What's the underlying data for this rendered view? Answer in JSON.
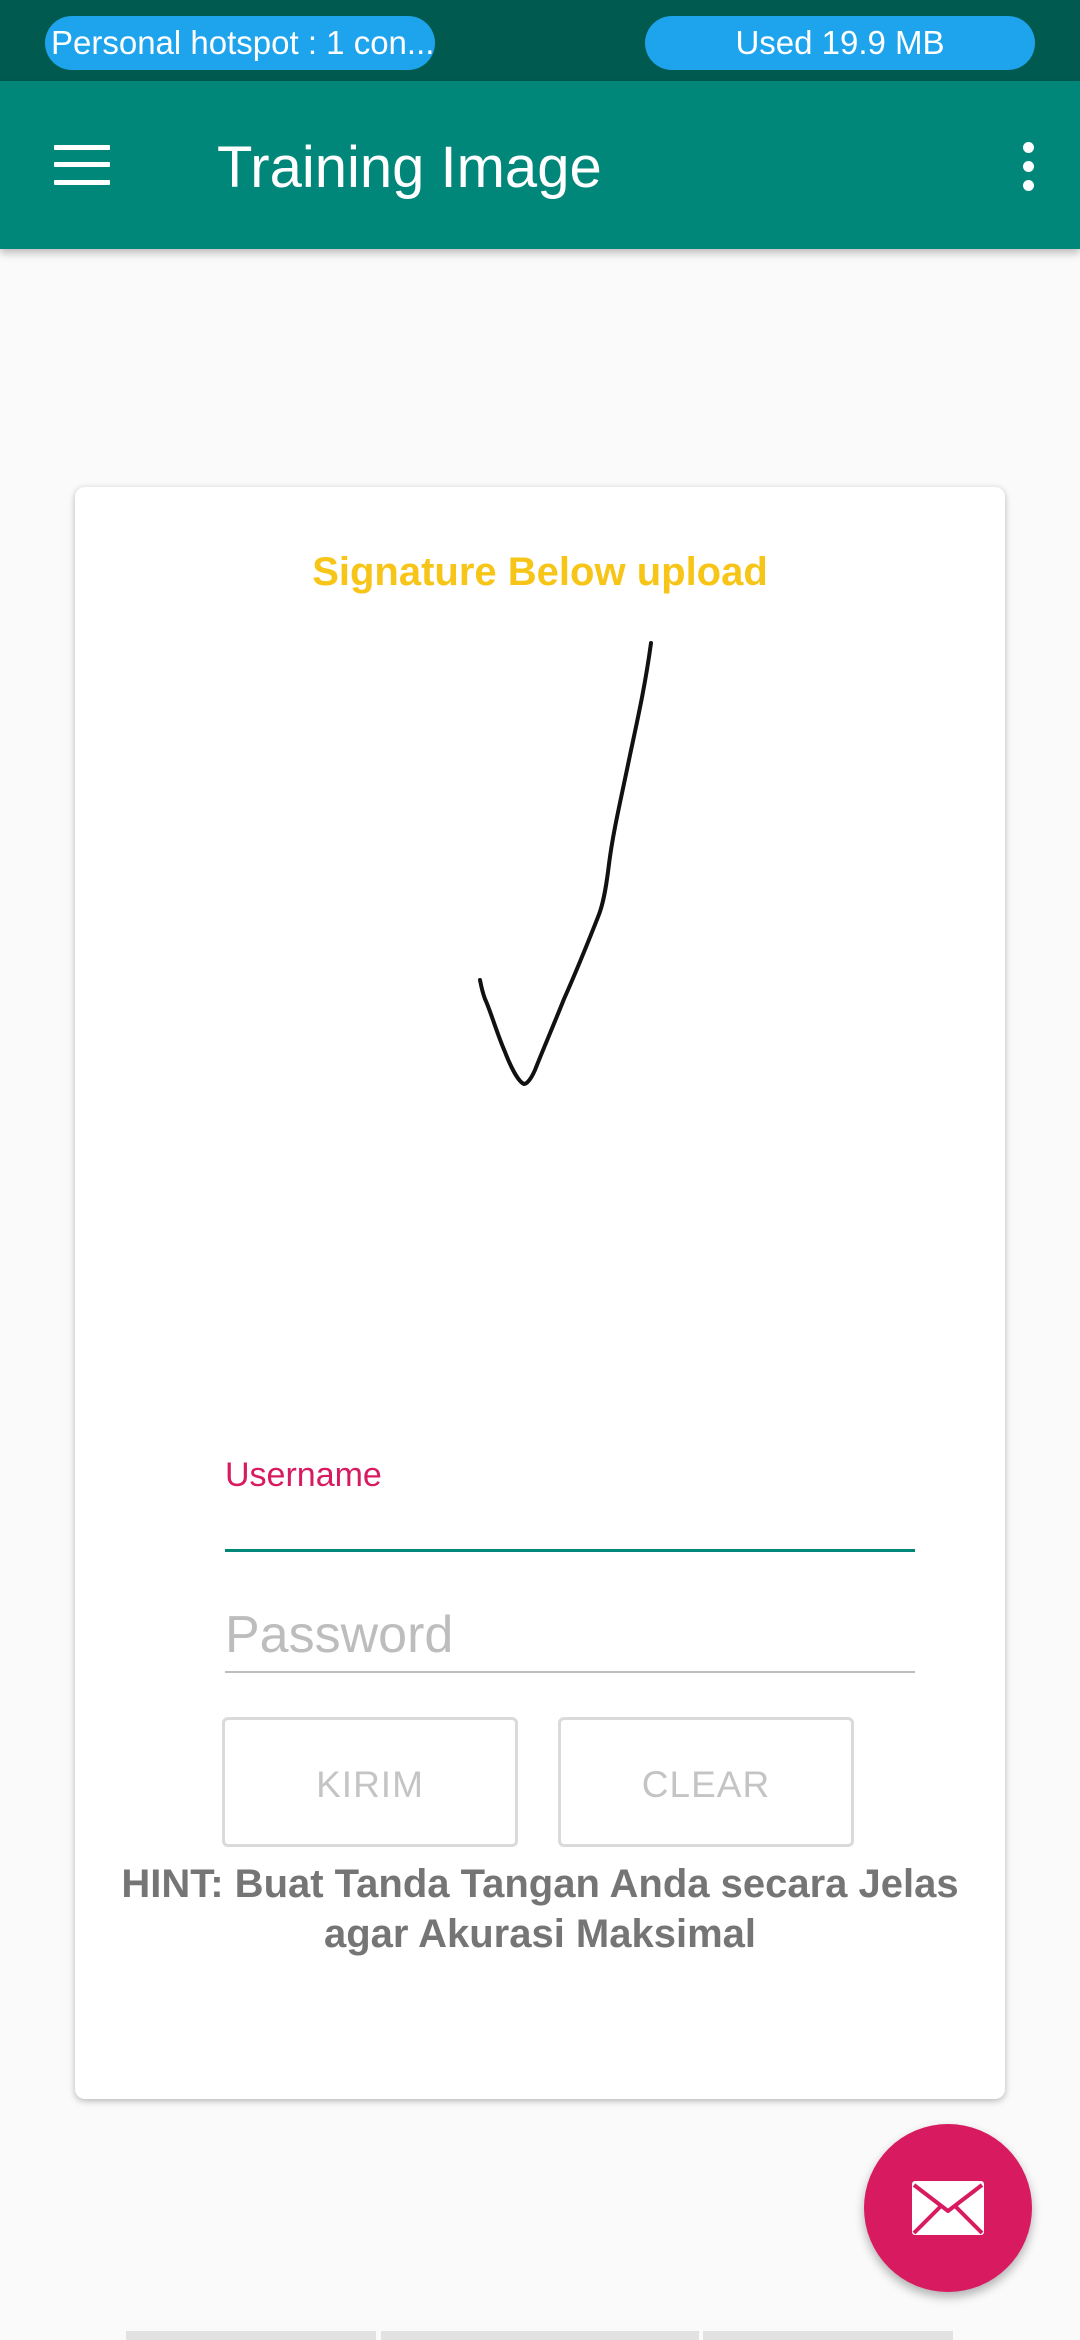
{
  "status_bar": {
    "hotspot_text": "Personal hotspot : 1 con...",
    "usage_text": "Used  19.9 MB"
  },
  "app_bar": {
    "title": "Training Image",
    "menu_icon": "hamburger-menu-icon",
    "overflow_icon": "more-vert-icon"
  },
  "card": {
    "signature_title": "Signature Below upload",
    "username_label": "Username",
    "username_value": "",
    "password_placeholder": "Password",
    "kirim_label": "KIRIM",
    "clear_label": "CLEAR",
    "hint": "HINT: Buat Tanda Tangan Anda secara Jelas agar Akurasi Maksimal"
  },
  "fab": {
    "icon": "mail-icon"
  },
  "colors": {
    "status_bar": "#005a4f",
    "app_bar": "#00877a",
    "accent": "#d81b60",
    "title_yellow": "#f7c518",
    "pill_blue": "#1ea4ec"
  }
}
